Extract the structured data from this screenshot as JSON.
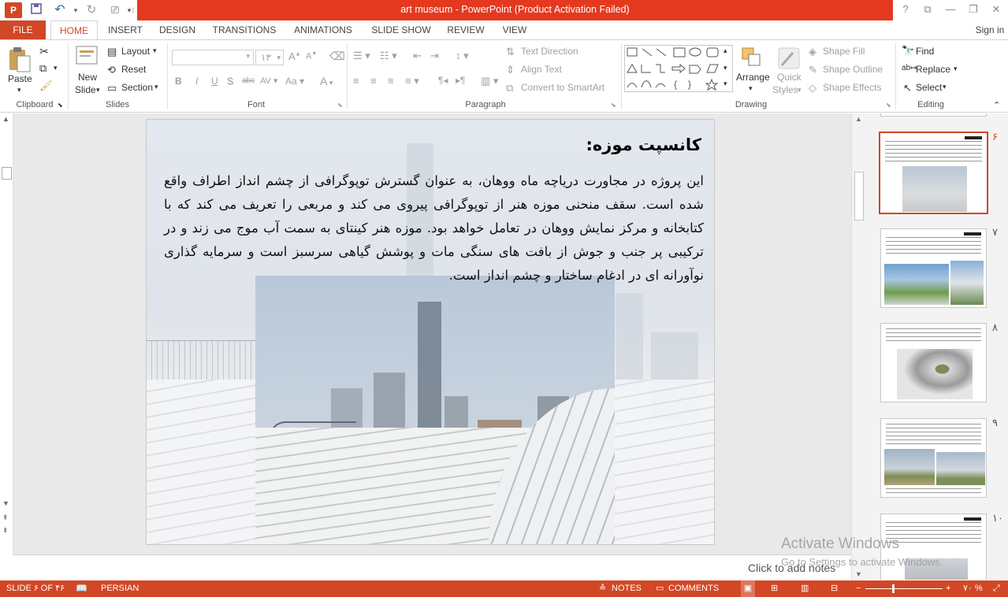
{
  "window": {
    "title": "art museum -  PowerPoint (Product Activation Failed)",
    "sign_in": "Sign in",
    "help": "?",
    "controls": [
      "ribbon-display",
      "minimize",
      "maximize",
      "close"
    ]
  },
  "quick_access": [
    "powerpoint-logo-icon",
    "save-icon",
    "undo-icon",
    "redo-icon",
    "start-from-beginning-icon",
    "customize-qat-icon"
  ],
  "tabs": {
    "file": "FILE",
    "home": "HOME",
    "insert": "INSERT",
    "design": "DESIGN",
    "transitions": "TRANSITIONS",
    "animations": "ANIMATIONS",
    "slide_show": "SLIDE SHOW",
    "review": "REVIEW",
    "view": "VIEW"
  },
  "ribbon": {
    "clipboard": {
      "label": "Clipboard",
      "paste": "Paste"
    },
    "slides": {
      "label": "Slides",
      "new_slide_line1": "New",
      "new_slide_line2": "Slide",
      "layout": "Layout",
      "reset": "Reset",
      "section": "Section"
    },
    "font": {
      "label": "Font",
      "font_size": "۱۳",
      "font_name": "",
      "bold": "B",
      "italic": "I",
      "underline": "U",
      "shadow": "S",
      "strike": "abc",
      "spacing": "AV",
      "case": "Aa",
      "color": "A",
      "grow": "A",
      "shrink": "A"
    },
    "paragraph": {
      "label": "Paragraph",
      "text_direction": "Text Direction",
      "align_text": "Align Text",
      "convert_smartart": "Convert to SmartArt"
    },
    "drawing": {
      "label": "Drawing",
      "arrange": "Arrange",
      "quick_styles_line1": "Quick",
      "quick_styles_line2": "Styles",
      "shape_fill": "Shape Fill",
      "shape_outline": "Shape Outline",
      "shape_effects": "Shape Effects"
    },
    "editing": {
      "label": "Editing",
      "find": "Find",
      "replace": "Replace",
      "select": "Select"
    }
  },
  "slide": {
    "title": "کانسپت موزه:",
    "body": "این پروژه در مجاورت دریاچه ماه ووهان، به عنوان گسترش توپوگرافی از چشم انداز اطراف واقع شده است. سقف منحنی موزه هنر از توپوگرافی پیروی می کند و مربعی را تعریف می کند که با کتابخانه و مرکز نمایش ووهان در تعامل خواهد بود. موزه هنر کینتای به سمت آب موج می زند و در ترکیبی پر جنب و جوش از بافت های سنگی مات و پوشش گیاهی سرسبز است و سرمایه گذاری نوآورانه ای در ادغام ساختار و چشم انداز است."
  },
  "thumbnails": [
    {
      "number": "۶",
      "selected": true
    },
    {
      "number": "۷",
      "selected": false
    },
    {
      "number": "۸",
      "selected": false
    },
    {
      "number": "۹",
      "selected": false
    },
    {
      "number": "۱۰",
      "selected": false
    }
  ],
  "notes": {
    "placeholder": "Click to add notes"
  },
  "watermark": {
    "line1": "Activate Windows",
    "line2": "Go to Settings to activate Windows."
  },
  "status": {
    "slide_info": "SLIDE ۶ OF ۴۶",
    "language": "PERSIAN",
    "notes": "NOTES",
    "comments": "COMMENTS",
    "zoom": "۷۰ %"
  },
  "colors": {
    "accent": "#d24726",
    "title_bar": "#e4391f"
  }
}
